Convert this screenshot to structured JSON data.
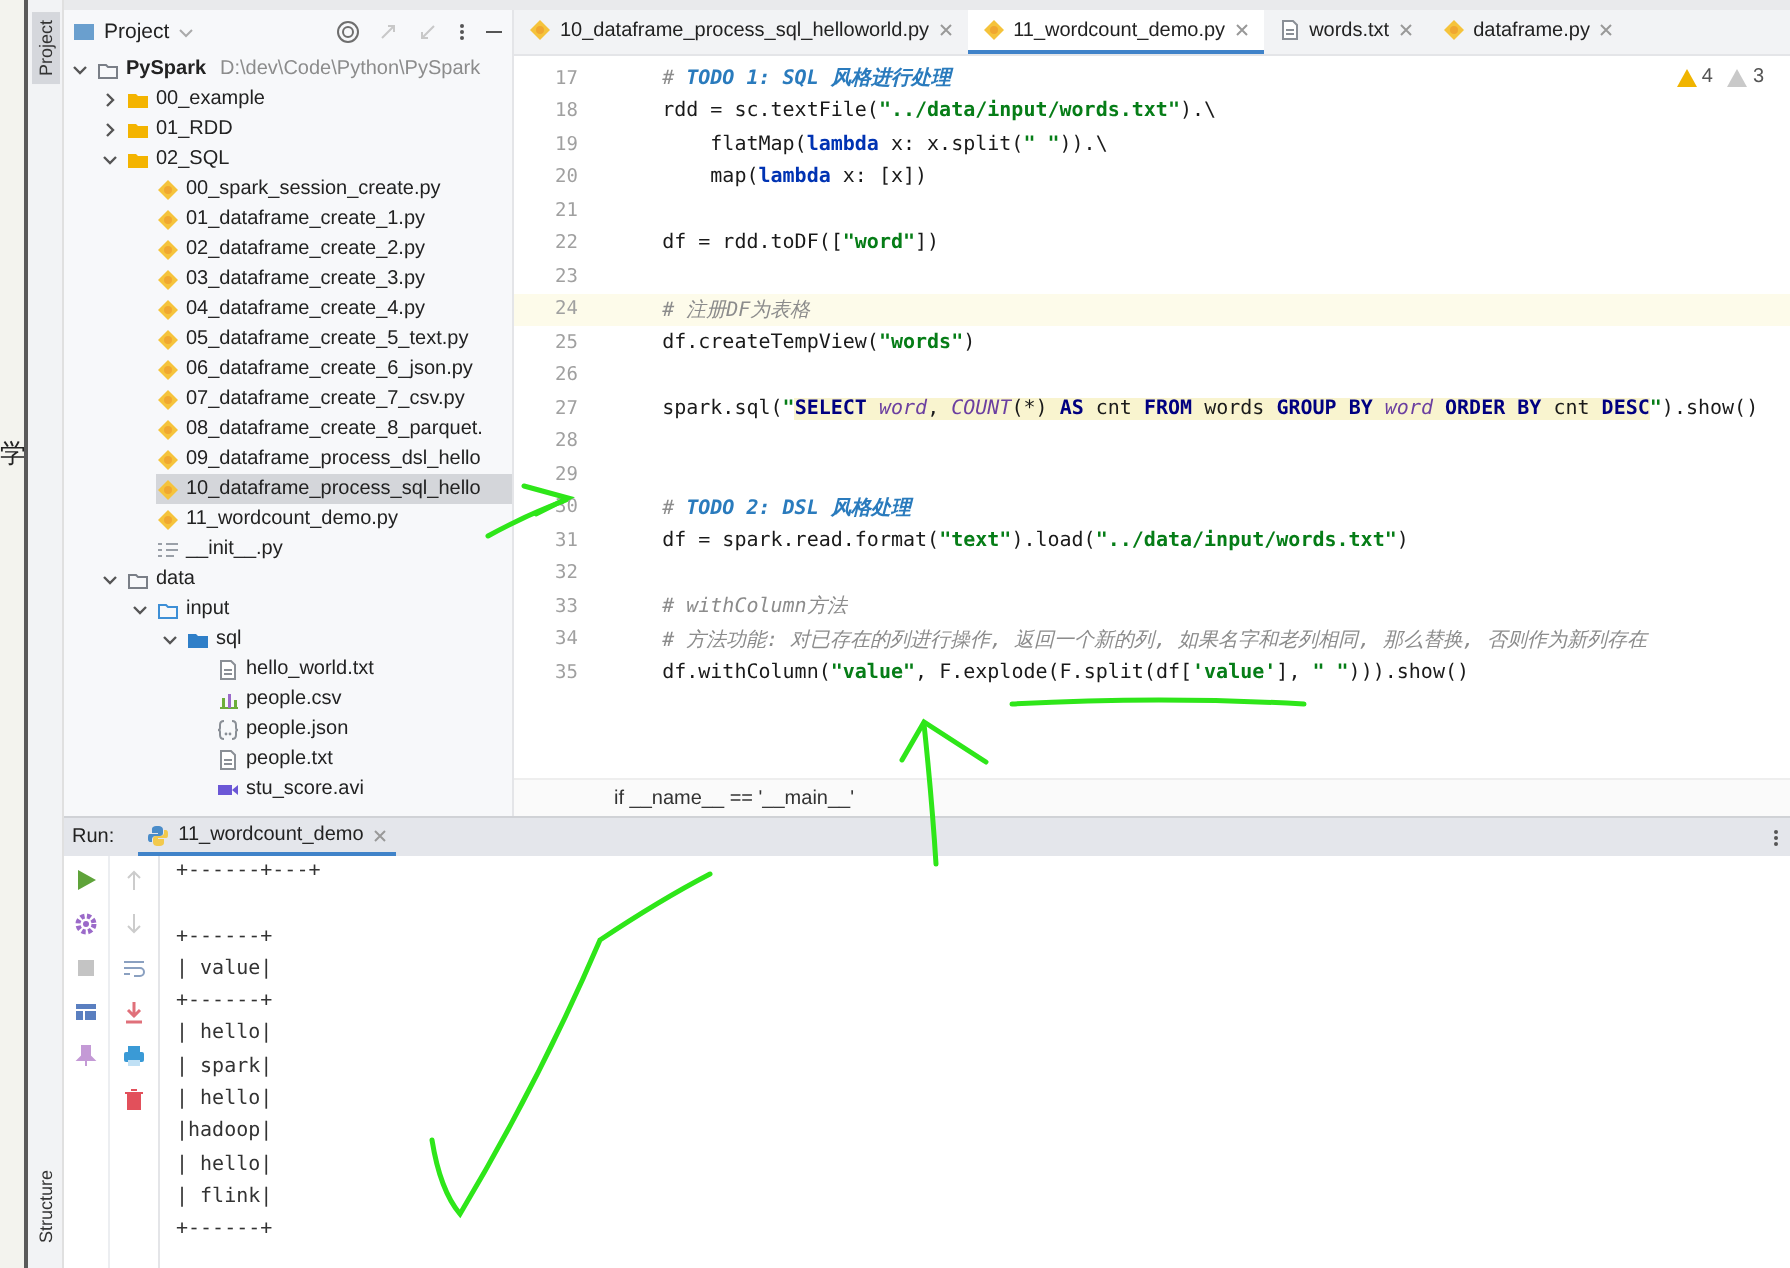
{
  "background_window": {
    "text": "学"
  },
  "side_tabs": {
    "top": {
      "label": "Project",
      "selected": true
    },
    "bottom": {
      "label": "Structure",
      "selected": false
    }
  },
  "project_panel": {
    "title": "Project",
    "tree": [
      {
        "kind": "project",
        "label": "PySpark",
        "path": "D:\\dev\\Code\\Python\\PySpark",
        "expanded": true,
        "selected": false,
        "children": [
          {
            "kind": "folder",
            "label": "00_example",
            "expanded": false,
            "selected": false
          },
          {
            "kind": "folder",
            "label": "01_RDD",
            "expanded": false,
            "selected": false
          },
          {
            "kind": "folder",
            "label": "02_SQL",
            "expanded": true,
            "selected": false,
            "children": [
              {
                "kind": "python",
                "label": "00_spark_session_create.py",
                "selected": false
              },
              {
                "kind": "python",
                "label": "01_dataframe_create_1.py",
                "selected": false
              },
              {
                "kind": "python",
                "label": "02_dataframe_create_2.py",
                "selected": false
              },
              {
                "kind": "python",
                "label": "03_dataframe_create_3.py",
                "selected": false
              },
              {
                "kind": "python",
                "label": "04_dataframe_create_4.py",
                "selected": false
              },
              {
                "kind": "python",
                "label": "05_dataframe_create_5_text.py",
                "selected": false
              },
              {
                "kind": "python",
                "label": "06_dataframe_create_6_json.py",
                "selected": false
              },
              {
                "kind": "python",
                "label": "07_dataframe_create_7_csv.py",
                "selected": false
              },
              {
                "kind": "python",
                "label": "08_dataframe_create_8_parquet.",
                "selected": false
              },
              {
                "kind": "python",
                "label": "09_dataframe_process_dsl_hello",
                "selected": false
              },
              {
                "kind": "python",
                "label": "10_dataframe_process_sql_hello",
                "selected": true
              },
              {
                "kind": "python",
                "label": "11_wordcount_demo.py",
                "selected": false
              },
              {
                "kind": "init",
                "label": "__init__.py",
                "selected": false
              }
            ]
          },
          {
            "kind": "dir",
            "label": "data",
            "expanded": true,
            "selected": false,
            "children": [
              {
                "kind": "source",
                "label": "input",
                "expanded": true,
                "selected": false,
                "children": [
                  {
                    "kind": "package",
                    "label": "sql",
                    "expanded": true,
                    "selected": false,
                    "children": [
                      {
                        "kind": "text",
                        "label": "hello_world.txt",
                        "selected": false
                      },
                      {
                        "kind": "csv",
                        "label": "people.csv",
                        "selected": false
                      },
                      {
                        "kind": "json",
                        "label": "people.json",
                        "selected": false
                      },
                      {
                        "kind": "text",
                        "label": "people.txt",
                        "selected": false
                      },
                      {
                        "kind": "video",
                        "label": "stu_score.avi",
                        "selected": false
                      }
                    ]
                  }
                ]
              }
            ]
          }
        ]
      }
    ]
  },
  "editor": {
    "tabs": [
      {
        "label": "10_dataframe_process_sql_helloworld.py",
        "kind": "python",
        "selected": false
      },
      {
        "label": "11_wordcount_demo.py",
        "kind": "python",
        "selected": true
      },
      {
        "label": "words.txt",
        "kind": "text",
        "selected": false
      },
      {
        "label": "dataframe.py",
        "kind": "python",
        "selected": false
      }
    ],
    "inspections": {
      "warnings": "4",
      "weak_warnings": "3"
    },
    "lines": [
      {
        "number": "17",
        "current": false,
        "segments": [
          {
            "kind": "comment",
            "text": "    # "
          },
          {
            "kind": "todo",
            "text": "TODO 1: SQL 风格进行处理"
          }
        ]
      },
      {
        "number": "18",
        "current": false,
        "segments": [
          {
            "kind": "plain",
            "text": "    rdd = sc.textFile("
          },
          {
            "kind": "string",
            "text": "\"../data/input/words.txt\""
          },
          {
            "kind": "plain",
            "text": ").\\"
          }
        ]
      },
      {
        "number": "19",
        "current": false,
        "segments": [
          {
            "kind": "plain",
            "text": "        flatMap("
          },
          {
            "kind": "keyword",
            "text": "lambda"
          },
          {
            "kind": "plain",
            "text": " x: x.split("
          },
          {
            "kind": "string",
            "text": "\" \""
          },
          {
            "kind": "plain",
            "text": ")).\\"
          }
        ]
      },
      {
        "number": "20",
        "current": false,
        "segments": [
          {
            "kind": "plain",
            "text": "        map("
          },
          {
            "kind": "keyword",
            "text": "lambda"
          },
          {
            "kind": "plain",
            "text": " x: [x])"
          }
        ]
      },
      {
        "number": "21",
        "current": false
      },
      {
        "number": "22",
        "current": false,
        "segments": [
          {
            "kind": "plain",
            "text": "    df = rdd.toDF(["
          },
          {
            "kind": "string",
            "text": "\"word\""
          },
          {
            "kind": "plain",
            "text": "])"
          }
        ]
      },
      {
        "number": "23",
        "current": false
      },
      {
        "number": "24",
        "current": true,
        "segments": [
          {
            "kind": "comment",
            "text": "    # 注册DF为表格"
          }
        ]
      },
      {
        "number": "25",
        "current": false,
        "segments": [
          {
            "kind": "plain",
            "text": "    df.createTempView("
          },
          {
            "kind": "string",
            "text": "\"words\""
          },
          {
            "kind": "plain",
            "text": ")"
          }
        ]
      },
      {
        "number": "26",
        "current": false
      },
      {
        "number": "27",
        "current": false,
        "segments": [
          {
            "kind": "plain",
            "text": "    spark.sql("
          },
          {
            "kind": "string",
            "text": "\""
          },
          {
            "kind": "sql-keyword",
            "text": "SELECT "
          },
          {
            "kind": "sql-ident",
            "text": "word"
          },
          {
            "kind": "sql",
            "text": ", "
          },
          {
            "kind": "sql-ident",
            "text": "COUNT"
          },
          {
            "kind": "sql",
            "text": "(*) "
          },
          {
            "kind": "sql-keyword",
            "text": "AS "
          },
          {
            "kind": "sql",
            "text": "cnt "
          },
          {
            "kind": "sql-keyword",
            "text": "FROM "
          },
          {
            "kind": "sql",
            "text": "words "
          },
          {
            "kind": "sql-keyword",
            "text": "GROUP BY "
          },
          {
            "kind": "sql-ident",
            "text": "word "
          },
          {
            "kind": "sql-keyword",
            "text": "ORDER BY "
          },
          {
            "kind": "sql",
            "text": "cnt "
          },
          {
            "kind": "sql-keyword",
            "text": "DESC"
          },
          {
            "kind": "string",
            "text": "\""
          },
          {
            "kind": "plain",
            "text": ").show()"
          }
        ]
      },
      {
        "number": "28",
        "current": false
      },
      {
        "number": "29",
        "current": false
      },
      {
        "number": "30",
        "current": false,
        "segments": [
          {
            "kind": "comment",
            "text": "    # "
          },
          {
            "kind": "todo",
            "text": "TODO 2: DSL 风格处理"
          }
        ]
      },
      {
        "number": "31",
        "current": false,
        "segments": [
          {
            "kind": "plain",
            "text": "    df = spark.read.format("
          },
          {
            "kind": "string",
            "text": "\"text\""
          },
          {
            "kind": "plain",
            "text": ").load("
          },
          {
            "kind": "string",
            "text": "\"../data/input/words.txt\""
          },
          {
            "kind": "plain",
            "text": ")"
          }
        ]
      },
      {
        "number": "32",
        "current": false
      },
      {
        "number": "33",
        "current": false,
        "segments": [
          {
            "kind": "comment",
            "text": "    # withColumn方法"
          }
        ]
      },
      {
        "number": "34",
        "current": false,
        "segments": [
          {
            "kind": "comment",
            "text": "    # 方法功能: 对已存在的列进行操作, 返回一个新的列, 如果名字和老列相同, 那么替换, 否则作为新列存在"
          }
        ]
      },
      {
        "number": "35",
        "current": false,
        "segments": [
          {
            "kind": "plain",
            "text": "    df.withColumn("
          },
          {
            "kind": "string",
            "text": "\"value\""
          },
          {
            "kind": "plain",
            "text": ", F.explode(F.split(df["
          },
          {
            "kind": "string",
            "text": "'value'"
          },
          {
            "kind": "plain",
            "text": "], "
          },
          {
            "kind": "string",
            "text": "\" \""
          },
          {
            "kind": "plain",
            "text": "))).show()"
          }
        ]
      }
    ],
    "breadcrumb": "if __name__ == '__main__'"
  },
  "run_panel": {
    "title": "Run:",
    "tab": {
      "label": "11_wordcount_demo",
      "selected": true
    },
    "output_blocks": [
      [
        "+------+---+"
      ],
      [
        "+------+",
        "| value|",
        "+------+",
        "| hello|",
        "| spark|",
        "| hello|",
        "|hadoop|",
        "| hello|",
        "| flink|",
        "+------+"
      ]
    ]
  }
}
